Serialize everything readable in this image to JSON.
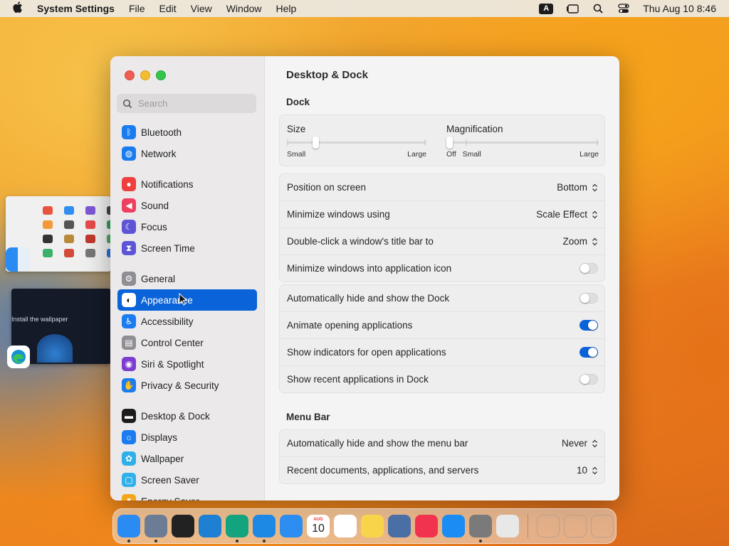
{
  "menubar": {
    "app_name": "System Settings",
    "menus": [
      "File",
      "Edit",
      "View",
      "Window",
      "Help"
    ],
    "input_badge": "A",
    "clock": "Thu Aug 10  8:46"
  },
  "stage": {
    "browser_thumb_text": "Install the wallpaper"
  },
  "window": {
    "search_placeholder": "Search",
    "sidebar": [
      {
        "label": "Bluetooth",
        "icon": "bluetooth-icon",
        "color": "#1a7cf0"
      },
      {
        "label": "Network",
        "icon": "globe-icon",
        "color": "#1a7cf0"
      },
      {
        "label": "Notifications",
        "icon": "bell-icon",
        "color": "#ef3f3d"
      },
      {
        "label": "Sound",
        "icon": "speaker-icon",
        "color": "#ef3f5f"
      },
      {
        "label": "Focus",
        "icon": "moon-icon",
        "color": "#5e55d6"
      },
      {
        "label": "Screen Time",
        "icon": "hourglass-icon",
        "color": "#5e55d6"
      },
      {
        "label": "General",
        "icon": "gear-icon",
        "color": "#8e8e93"
      },
      {
        "label": "Appearance",
        "icon": "appearance-icon",
        "color": "#1c1c1c"
      },
      {
        "label": "Accessibility",
        "icon": "accessibility-icon",
        "color": "#1a7cf0"
      },
      {
        "label": "Control Center",
        "icon": "control-center-icon",
        "color": "#8e8e93"
      },
      {
        "label": "Siri & Spotlight",
        "icon": "siri-icon",
        "color": "#7d3cd0"
      },
      {
        "label": "Privacy & Security",
        "icon": "hand-icon",
        "color": "#1a7cf0"
      },
      {
        "label": "Desktop & Dock",
        "icon": "dock-icon",
        "color": "#1c1c1c"
      },
      {
        "label": "Displays",
        "icon": "sun-icon",
        "color": "#1a7cf0"
      },
      {
        "label": "Wallpaper",
        "icon": "flower-icon",
        "color": "#30b0e8"
      },
      {
        "label": "Screen Saver",
        "icon": "screensaver-icon",
        "color": "#30b0e8"
      },
      {
        "label": "Energy Saver",
        "icon": "battery-icon",
        "color": "#f4a61c"
      }
    ],
    "selected_index": 7,
    "title": "Desktop & Dock",
    "dock_section": {
      "title": "Dock",
      "size": {
        "label": "Size",
        "min_label": "Small",
        "max_label": "Large",
        "value_fraction": 0.19
      },
      "magnification": {
        "label": "Magnification",
        "off_label": "Off",
        "min_label": "Small",
        "max_label": "Large",
        "value_fraction": 0.0
      },
      "popups": [
        {
          "label": "Position on screen",
          "value": "Bottom"
        },
        {
          "label": "Minimize windows using",
          "value": "Scale Effect"
        },
        {
          "label": "Double-click a window's title bar to",
          "value": "Zoom"
        }
      ],
      "minimize_into_icon": {
        "label": "Minimize windows into application icon",
        "on": false
      },
      "toggles": [
        {
          "label": "Automatically hide and show the Dock",
          "on": false
        },
        {
          "label": "Animate opening applications",
          "on": true
        },
        {
          "label": "Show indicators for open applications",
          "on": true
        },
        {
          "label": "Show recent applications in Dock",
          "on": false
        }
      ]
    },
    "menu_bar_section": {
      "title": "Menu Bar",
      "rows": [
        {
          "label": "Automatically hide and show the menu bar",
          "value": "Never"
        },
        {
          "label": "Recent documents, applications, and servers",
          "value": "10"
        }
      ]
    }
  },
  "dock": {
    "apps": [
      {
        "name": "finder-icon",
        "color": "#2a8cf2",
        "running": true
      },
      {
        "name": "preview-icon",
        "color": "#6c7c95",
        "running": true
      },
      {
        "name": "window-manager-icon",
        "color": "#222222",
        "running": false
      },
      {
        "name": "vscode-icon",
        "color": "#1f7fd2",
        "running": false
      },
      {
        "name": "edge-icon",
        "color": "#14a37f",
        "running": true
      },
      {
        "name": "safari-icon",
        "color": "#1e88e5",
        "running": true
      },
      {
        "name": "keynote-icon",
        "color": "#2e8df0",
        "running": false
      },
      {
        "name": "calendar-icon",
        "color": "#ffffff",
        "running": false
      },
      {
        "name": "reminders-icon",
        "color": "#ffffff",
        "running": false
      },
      {
        "name": "notes-icon",
        "color": "#f7d44a",
        "running": false
      },
      {
        "name": "xcode-icon",
        "color": "#4a6fa5",
        "running": false
      },
      {
        "name": "news-icon",
        "color": "#f2334f",
        "running": false
      },
      {
        "name": "app-store-icon",
        "color": "#1a8cf3",
        "running": false
      },
      {
        "name": "system-settings-icon",
        "color": "#7a7a7a",
        "running": true
      },
      {
        "name": "launchpad-icon",
        "color": "#e8e8e8",
        "running": false
      }
    ],
    "calendar": {
      "month": "AUG",
      "day": "10"
    },
    "right_items": [
      {
        "name": "help-icon"
      },
      {
        "name": "downloads-icon"
      },
      {
        "name": "trash-icon"
      }
    ]
  }
}
